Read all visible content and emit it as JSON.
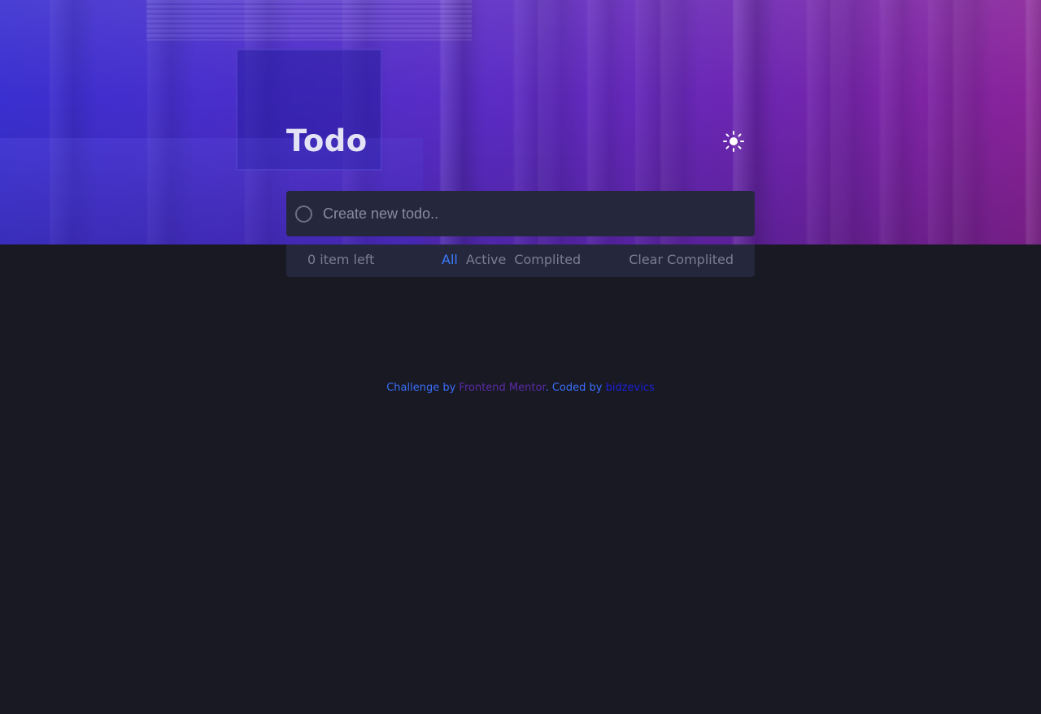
{
  "app": {
    "title": "Todo"
  },
  "theme_toggle": {
    "icon": "sun-icon"
  },
  "new_todo": {
    "placeholder": "Create new todo..",
    "value": ""
  },
  "footer_bar": {
    "items_left": "0 item left",
    "filters": [
      {
        "label": "All",
        "active": true
      },
      {
        "label": "Active",
        "active": false
      },
      {
        "label": "Complited",
        "active": false
      }
    ],
    "clear_label": "Clear Complited"
  },
  "attribution": {
    "prefix": "Challenge by ",
    "fm_link": "Frontend Mentor",
    "middle": ". Coded by ",
    "author_link": "bidzevics"
  },
  "colors": {
    "background": "#181923",
    "card": "#25273c",
    "accent": "#3a7bfd",
    "muted_text": "#7b7d94",
    "title": "#e4e2f5"
  }
}
